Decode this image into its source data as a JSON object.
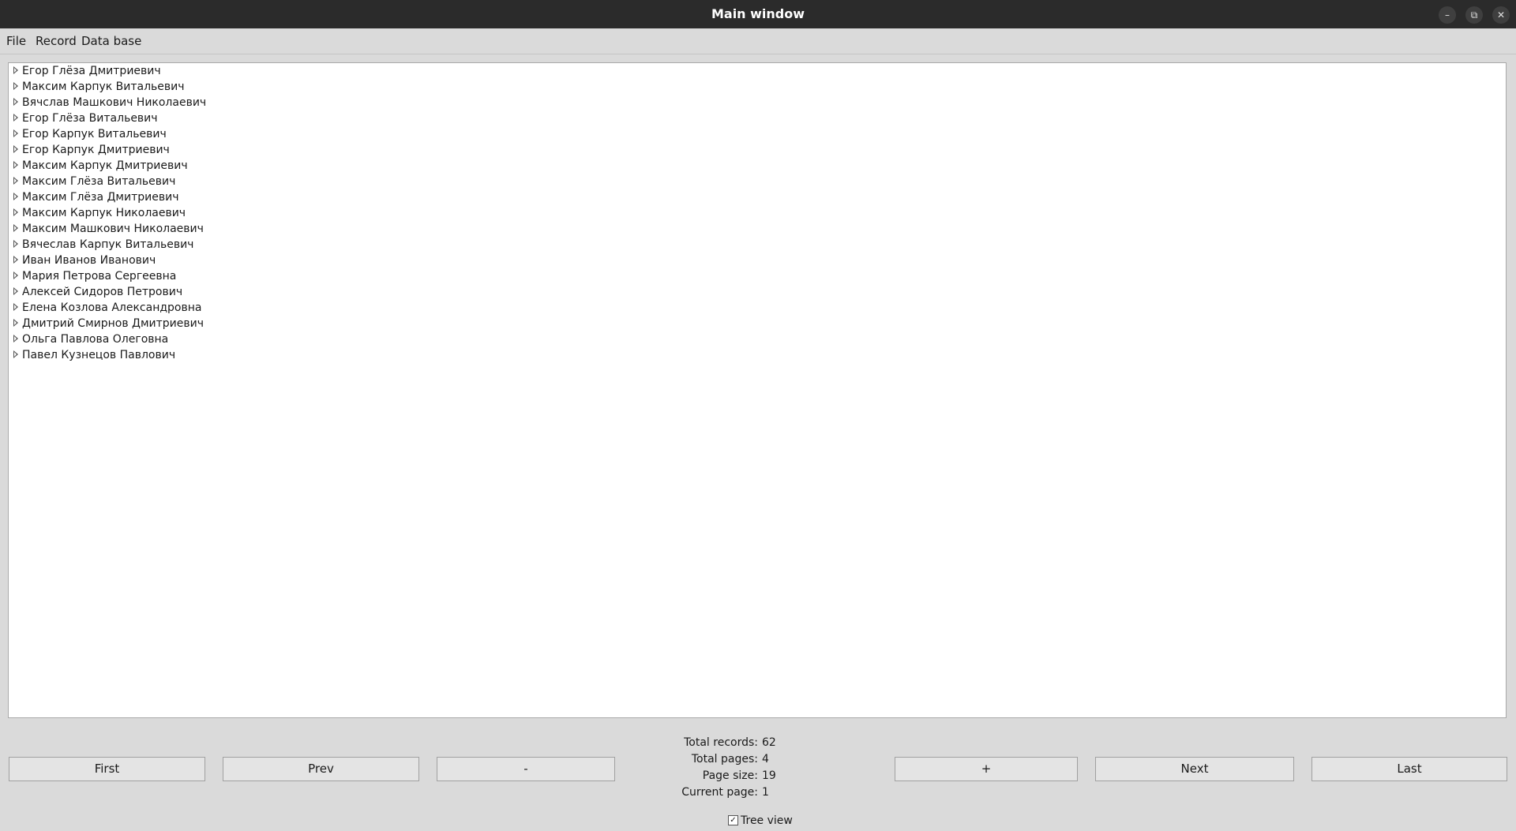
{
  "window": {
    "title": "Main window"
  },
  "menu": {
    "items": [
      "File",
      "Record",
      "Data base"
    ]
  },
  "tree": {
    "rows": [
      "Егор Глёза Дмитриевич",
      "Максим Карпук Витальевич",
      "Вячслав Машкович Николаевич",
      "Егор Глёза Витальевич",
      "Егор Карпук Витальевич",
      "Егор Карпук Дмитриевич",
      "Максим Карпук Дмитриевич",
      "Максим Глёза Витальевич",
      "Максим Глёза Дмитриевич",
      "Максим Карпук Николаевич",
      "Максим Машкович Николаевич",
      "Вячеслав Карпук Витальевич",
      "Иван Иванов Иванович",
      "Мария Петрова Сергеевна",
      "Алексей Сидоров Петрович",
      "Елена Козлова Александровна",
      "Дмитрий Смирнов Дмитриевич",
      "Ольга Павлова Олеговна",
      "Павел Кузнецов Павлович"
    ]
  },
  "nav": {
    "first": "First",
    "prev": "Prev",
    "minus": "-",
    "plus": "+",
    "next": "Next",
    "last": "Last"
  },
  "stats": {
    "total_records_label": "Total records:",
    "total_records": "62",
    "total_pages_label": "Total pages:",
    "total_pages": "4",
    "page_size_label": "Page size:",
    "page_size": "19",
    "current_page_label": "Current page:",
    "current_page": "1"
  },
  "tree_view": {
    "label": "Tree view",
    "checked": true
  }
}
